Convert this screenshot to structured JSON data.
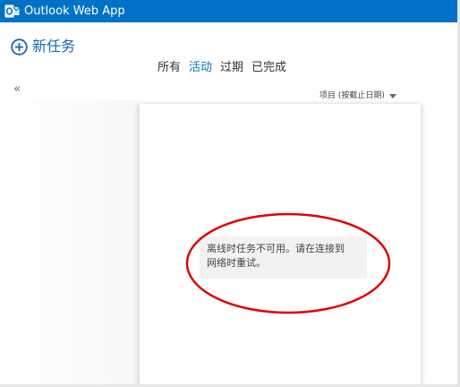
{
  "app": {
    "title": "Outlook Web App",
    "brand_icon": "outlook-icon",
    "brand_color": "#0072c6"
  },
  "toolbar": {
    "new_task_label": "新任务",
    "new_task_icon": "plus-circle-icon"
  },
  "filters": [
    {
      "label": "所有",
      "active": false
    },
    {
      "label": "活动",
      "active": true
    },
    {
      "label": "过期",
      "active": false
    },
    {
      "label": "已完成",
      "active": false
    }
  ],
  "navigation": {
    "collapse_label": "«"
  },
  "sort": {
    "label": "项目 (按截止日期)",
    "icon": "chevron-down-icon"
  },
  "message": {
    "line1": "离线时任务不可用。请在连接到",
    "line2": "网络时重试。"
  },
  "annotation": {
    "color": "#e00000"
  }
}
